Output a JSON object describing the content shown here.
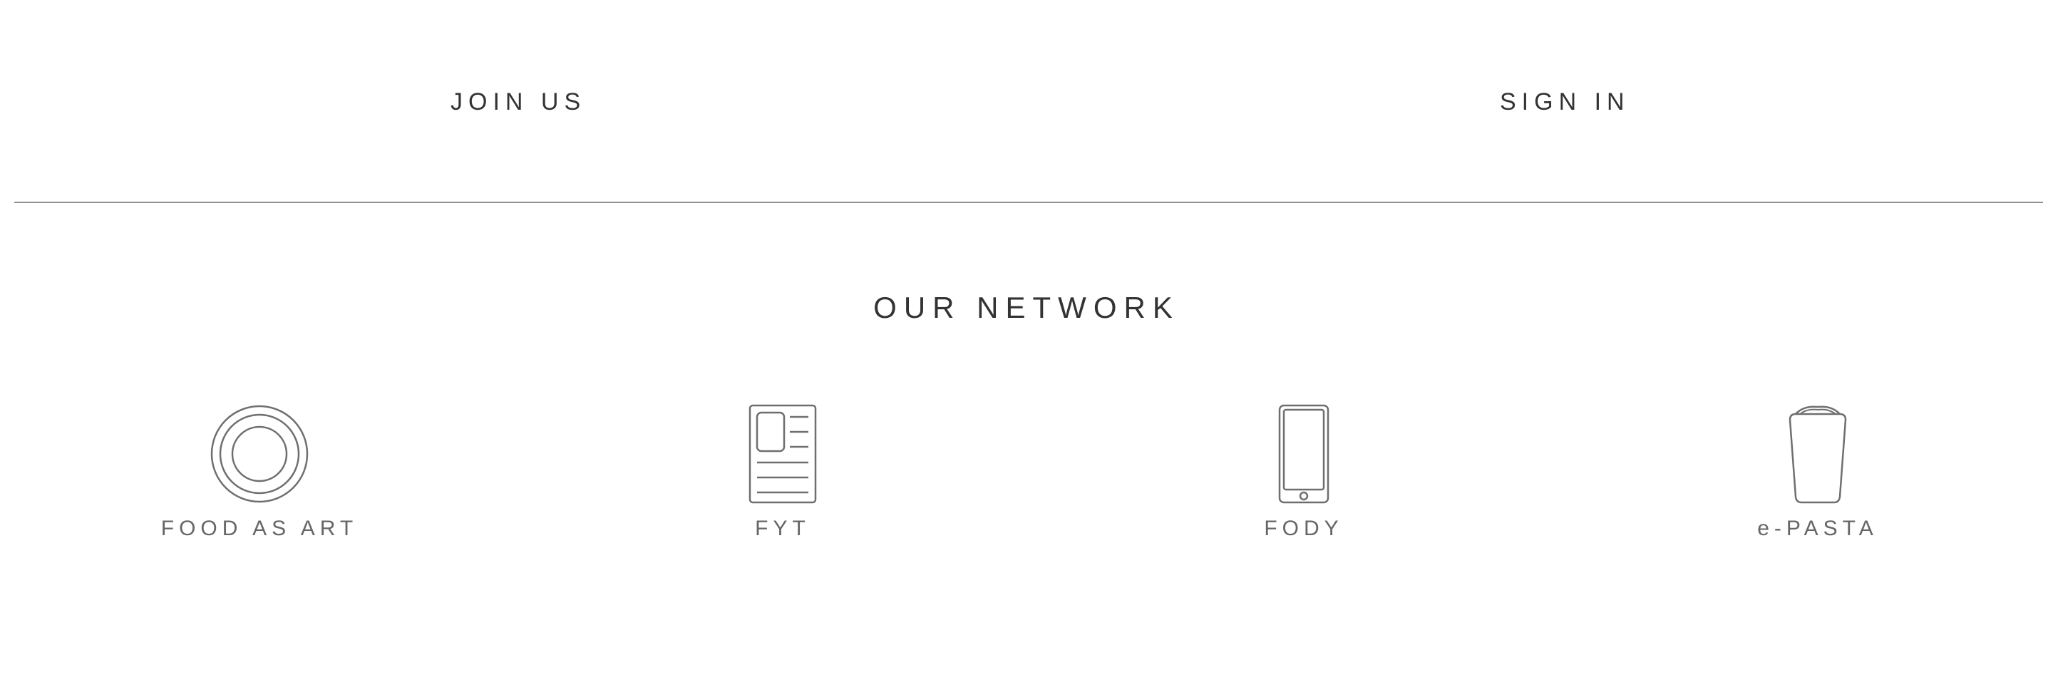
{
  "auth": {
    "join_label": "JOIN US",
    "signin_label": "SIGN IN"
  },
  "network": {
    "title": "OUR NETWORK",
    "items": [
      {
        "label": "FOOD AS ART",
        "icon": "plate-icon"
      },
      {
        "label": "FYT",
        "icon": "newspaper-icon"
      },
      {
        "label": "FODY",
        "icon": "phone-icon"
      },
      {
        "label": "e-PASTA",
        "icon": "cup-icon"
      }
    ]
  },
  "colors": {
    "text": "#333333",
    "muted": "#666666",
    "icon_stroke": "#6f6f6f",
    "divider": "#8f8f8f",
    "background": "#ffffff"
  }
}
